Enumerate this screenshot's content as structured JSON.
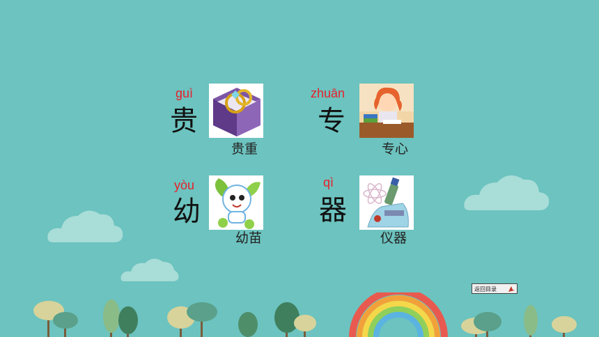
{
  "characters": [
    {
      "pinyin": "guì",
      "char": "贵",
      "word": "贵重",
      "picture": "ring-box-picture"
    },
    {
      "pinyin": "zhuān",
      "char": "专",
      "word": "专心",
      "picture": "girl-studying-picture"
    },
    {
      "pinyin": "yòu",
      "char": "幼",
      "word": "幼苗",
      "picture": "sprout-mascot-picture"
    },
    {
      "pinyin": "qì",
      "char": "器",
      "word": "仪器",
      "picture": "microscope-picture"
    }
  ],
  "nav": {
    "back_label": "返回目录"
  },
  "colors": {
    "background": "#6cc3bf",
    "pinyin": "#e8202a",
    "cloud": "#a9ddd8"
  }
}
